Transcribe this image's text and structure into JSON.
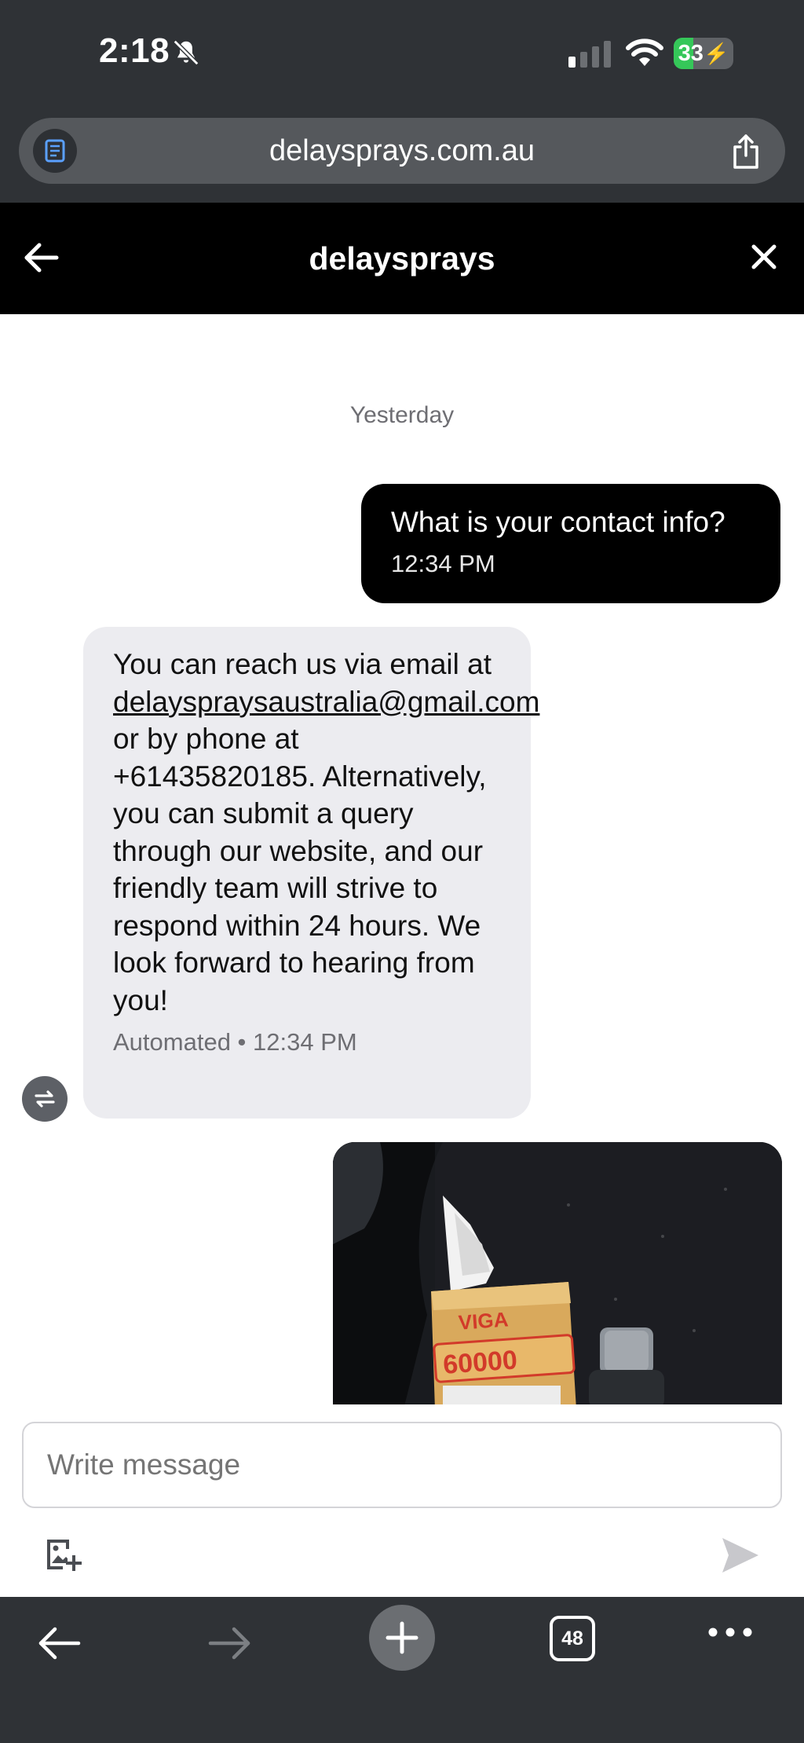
{
  "status_bar": {
    "time": "2:18",
    "battery": "33"
  },
  "browser": {
    "url": "delaysprays.com.au"
  },
  "chat_header": {
    "title": "delaysprays"
  },
  "chat": {
    "day_separator": "Yesterday",
    "messages": [
      {
        "direction": "outgoing",
        "text": "What is your contact info?",
        "time": "12:34 PM"
      },
      {
        "direction": "incoming",
        "text_before": "You can reach us via email at ",
        "email": "delayspraysaustralia@gmail.com",
        "text_after": " or by phone at +61435820185. Alternatively, you can submit a query through our website, and our friendly team will strive to respond within 24 hours. We look forward to hearing from you!",
        "meta": "Automated • 12:34 PM"
      }
    ],
    "photo": {
      "box_brand": "VIGA",
      "box_number": "60000"
    }
  },
  "composer": {
    "placeholder": "Write message"
  },
  "toolbar": {
    "tab_count": "48"
  }
}
